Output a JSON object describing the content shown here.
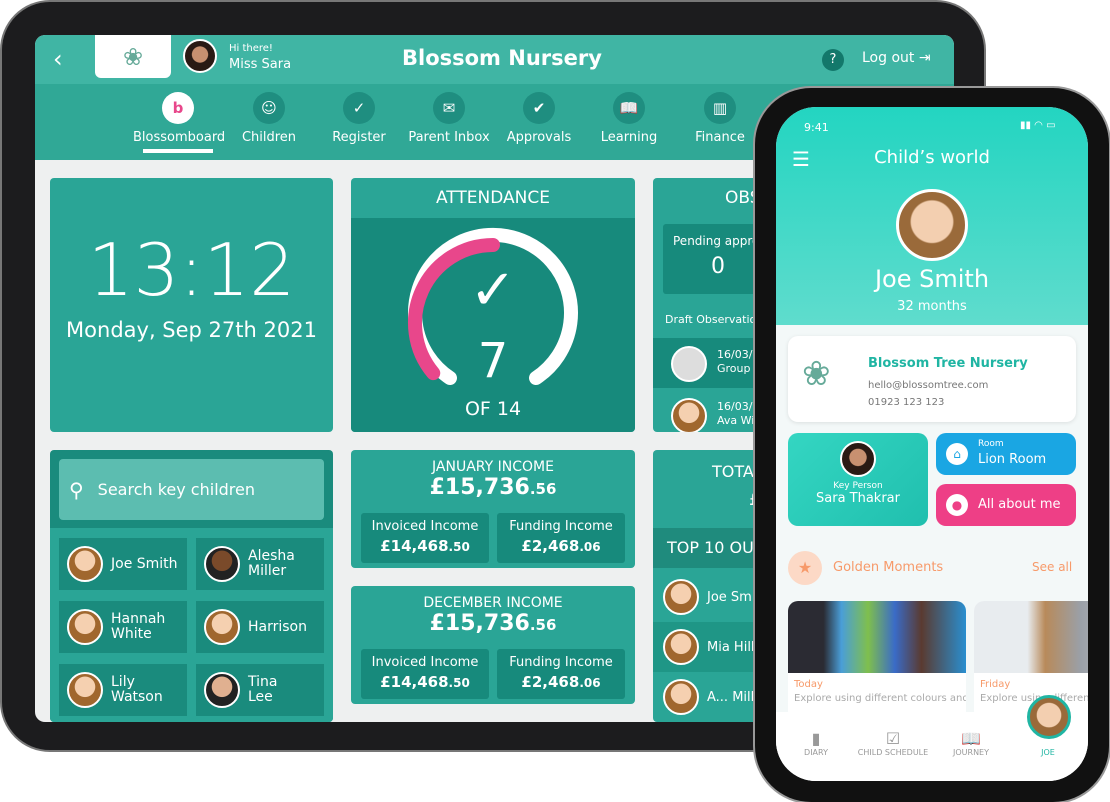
{
  "tablet": {
    "header": {
      "greeting": "Hi there!",
      "user": "Miss Sara",
      "title": "Blossom Nursery",
      "help": "?",
      "logout": "Log out"
    },
    "nav": [
      {
        "label": "Blossomboard",
        "icon": "blossom-icon"
      },
      {
        "label": "Children",
        "icon": "smiley-icon"
      },
      {
        "label": "Register",
        "icon": "calendar-check-icon"
      },
      {
        "label": "Parent Inbox",
        "icon": "inbox-icon"
      },
      {
        "label": "Approvals",
        "icon": "clipboard-icon"
      },
      {
        "label": "Learning",
        "icon": "book-icon"
      },
      {
        "label": "Finance",
        "icon": "chart-icon"
      }
    ],
    "clock": {
      "time": "13:12",
      "date": "Monday, Sep 27th 2021"
    },
    "attendance": {
      "title": "ATTENDANCE",
      "present": "7",
      "of": "OF 14",
      "fraction": 0.5,
      "accent": "#e8478b"
    },
    "observations": {
      "title": "OBS",
      "pending_label": "Pending approv",
      "pending_value": "0",
      "draft_label": "Draft Observatio",
      "items": [
        {
          "date": "16/03/20",
          "name": "Group ("
        },
        {
          "date": "16/03/20",
          "name": "Ava Wi"
        }
      ]
    },
    "search": {
      "placeholder": "Search key children"
    },
    "children": [
      "Joe Smith",
      "Alesha Miller",
      "Hannah White",
      "Harrison",
      "Lily Watson",
      "Tina Lee"
    ],
    "january": {
      "title": "JANUARY INCOME",
      "total_main": "£15,736",
      "total_dec": ".56",
      "invoiced_label": "Invoiced Income",
      "invoiced_main": "£14,468",
      "invoiced_dec": ".50",
      "funding_label": "Funding Income",
      "funding_main": "£2,468",
      "funding_dec": ".06"
    },
    "december": {
      "title": "DECEMBER INCOME",
      "total_main": "£15,736",
      "total_dec": ".56",
      "invoiced_label": "Invoiced Income",
      "invoiced_main": "£14,468",
      "invoiced_dec": ".50",
      "funding_label": "Funding Income",
      "funding_main": "£2,468",
      "funding_dec": ".06"
    },
    "total": {
      "title": "TOTAL",
      "value": "£",
      "top_title": "TOP 10 OUT",
      "top": [
        "Joe Smith",
        "Mia Hill",
        "A... Mill"
      ]
    }
  },
  "phone": {
    "time": "9:41",
    "title": "Child’s world",
    "child": "Joe Smith",
    "age": "32 months",
    "nursery": {
      "name": "Blossom Tree Nursery",
      "email": "hello@blossomtree.com",
      "phone": "01923 123 123"
    },
    "key_person": {
      "label": "Key Person",
      "name": "Sara Thakrar"
    },
    "room": {
      "label": "Room",
      "name": "Lion Room"
    },
    "about": "All about me",
    "golden": {
      "title": "Golden Moments",
      "see_all": "See all",
      "cards": [
        {
          "day": "Today",
          "text": "Explore using different colours and"
        },
        {
          "day": "Friday",
          "text": "Explore using different"
        }
      ]
    },
    "tabs": [
      {
        "label": "DIARY",
        "icon": "diary-icon"
      },
      {
        "label": "CHILD SCHEDULE",
        "icon": "schedule-icon"
      },
      {
        "label": "JOURNEY",
        "icon": "journey-icon"
      },
      {
        "label": "JOE",
        "icon": "avatar"
      }
    ],
    "accent": "#25d3bf",
    "orange": "#f79a6a",
    "pink": "#ee3f86",
    "blue": "#1aa6e3"
  }
}
